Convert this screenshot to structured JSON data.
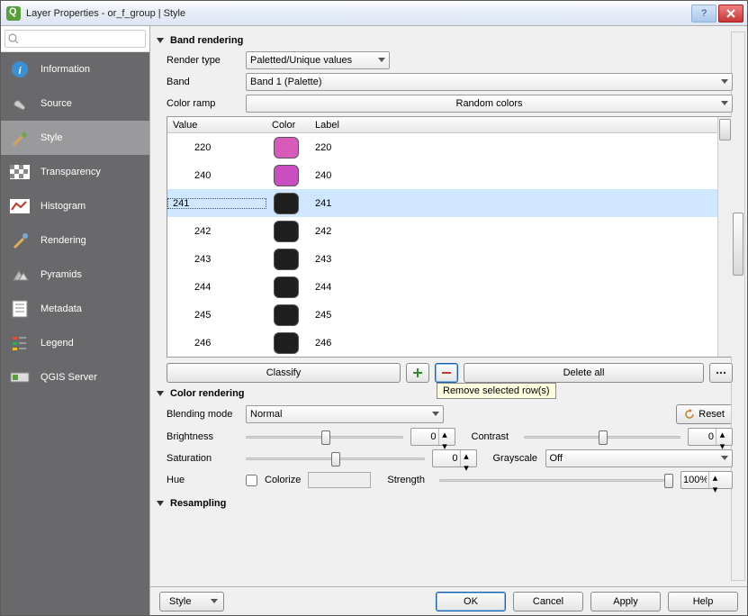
{
  "window": {
    "title": "Layer Properties - or_f_group | Style"
  },
  "sidebar": {
    "search_placeholder": "",
    "items": [
      {
        "label": "Information"
      },
      {
        "label": "Source"
      },
      {
        "label": "Style"
      },
      {
        "label": "Transparency"
      },
      {
        "label": "Histogram"
      },
      {
        "label": "Rendering"
      },
      {
        "label": "Pyramids"
      },
      {
        "label": "Metadata"
      },
      {
        "label": "Legend"
      },
      {
        "label": "QGIS Server"
      }
    ]
  },
  "band_rendering": {
    "title": "Band rendering",
    "render_type_label": "Render type",
    "render_type_value": "Paletted/Unique values",
    "band_label": "Band",
    "band_value": "Band 1 (Palette)",
    "ramp_label": "Color ramp",
    "ramp_value": "Random colors",
    "headers": {
      "value": "Value",
      "color": "Color",
      "label": "Label"
    },
    "rows": [
      {
        "value": "220",
        "label": "220",
        "color": "#d95bb9",
        "selected": false
      },
      {
        "value": "240",
        "label": "240",
        "color": "#c94fc0",
        "selected": false
      },
      {
        "value": "241",
        "label": "241",
        "color": "#1f1f1f",
        "selected": true
      },
      {
        "value": "242",
        "label": "242",
        "color": "#1f1f1f",
        "selected": false
      },
      {
        "value": "243",
        "label": "243",
        "color": "#1f1f1f",
        "selected": false
      },
      {
        "value": "244",
        "label": "244",
        "color": "#1f1f1f",
        "selected": false
      },
      {
        "value": "245",
        "label": "245",
        "color": "#1f1f1f",
        "selected": false
      },
      {
        "value": "246",
        "label": "246",
        "color": "#1f1f1f",
        "selected": false
      }
    ],
    "classify": "Classify",
    "delete_all": "Delete all",
    "tooltip": "Remove selected row(s)"
  },
  "color_rendering": {
    "title": "Color rendering",
    "blend_label": "Blending mode",
    "blend_value": "Normal",
    "reset": "Reset",
    "brightness_label": "Brightness",
    "brightness_value": "0",
    "contrast_label": "Contrast",
    "contrast_value": "0",
    "saturation_label": "Saturation",
    "saturation_value": "0",
    "grayscale_label": "Grayscale",
    "grayscale_value": "Off",
    "hue_label": "Hue",
    "colorize_label": "Colorize",
    "strength_label": "Strength",
    "strength_value": "100%"
  },
  "resampling": {
    "title": "Resampling"
  },
  "footer": {
    "style": "Style",
    "ok": "OK",
    "cancel": "Cancel",
    "apply": "Apply",
    "help": "Help"
  }
}
